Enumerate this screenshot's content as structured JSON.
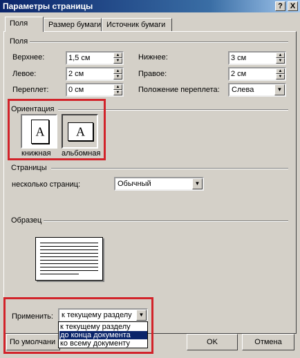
{
  "window": {
    "title": "Параметры страницы",
    "help_button": "?",
    "close_button": "X"
  },
  "tabs": [
    {
      "label": "Поля",
      "active": true
    },
    {
      "label": "Размер бумаги",
      "active": false
    },
    {
      "label": "Источник бумаги",
      "active": false
    }
  ],
  "margins": {
    "group_label": "Поля",
    "top_label": "Верхнее:",
    "top_value": "1,5 см",
    "bottom_label": "Нижнее:",
    "bottom_value": "3 см",
    "left_label": "Левое:",
    "left_value": "2 см",
    "right_label": "Правое:",
    "right_value": "2 см",
    "gutter_label": "Переплет:",
    "gutter_value": "0 см",
    "gutter_pos_label": "Положение переплета:",
    "gutter_pos_value": "Слева"
  },
  "orientation": {
    "group_label": "Ориентация",
    "portrait_label": "книжная",
    "landscape_label": "альбомная",
    "icon_glyph": "A",
    "selected": "landscape"
  },
  "pages": {
    "group_label": "Страницы",
    "multiple_label": "несколько страниц:",
    "multiple_value": "Обычный"
  },
  "preview": {
    "group_label": "Образец"
  },
  "apply": {
    "label": "Применить:",
    "value": "к текущему разделу",
    "options": [
      "к текущему разделу",
      "до конца документа",
      "ко всему документу"
    ],
    "highlighted_index": 1
  },
  "buttons": {
    "default_label": "По умолчани",
    "ok_label": "OK",
    "cancel_label": "Отмена"
  },
  "colors": {
    "dialog_bg": "#d4d0c8",
    "title_bar": "#0a246a",
    "highlight_box": "#d2232a",
    "selection": "#0a246a"
  }
}
